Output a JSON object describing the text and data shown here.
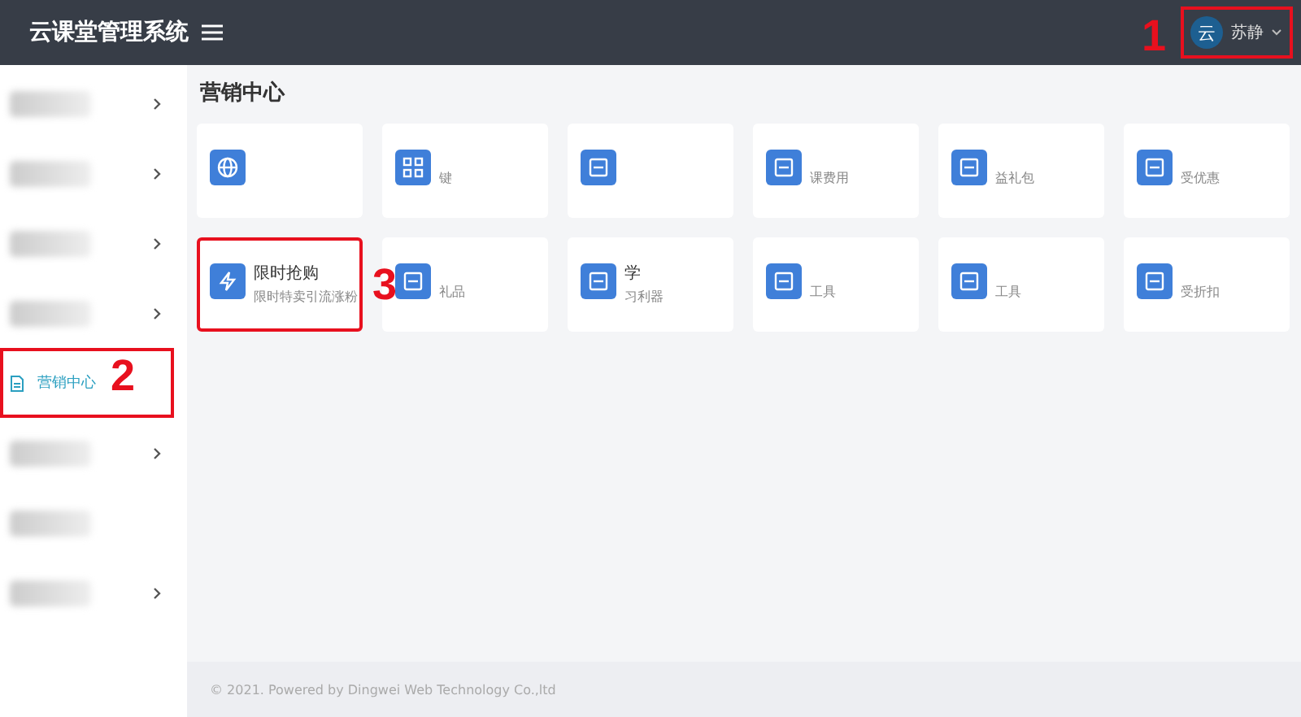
{
  "header": {
    "title": "云课堂管理系统",
    "user": {
      "name": "苏静",
      "avatar_text": "云",
      "callout": "1"
    }
  },
  "sidebar": {
    "items": [
      {
        "kind": "group",
        "selected": false
      },
      {
        "kind": "group",
        "selected": false
      },
      {
        "kind": "group",
        "selected": false
      },
      {
        "kind": "group",
        "selected": false
      },
      {
        "kind": "link",
        "label": "营销中心",
        "selected": true,
        "callout": "2"
      },
      {
        "kind": "group",
        "selected": false
      },
      {
        "kind": "link",
        "selected": false
      },
      {
        "kind": "group",
        "selected": false
      }
    ]
  },
  "page_title": "营销中心",
  "cards": [
    {
      "kind": "globe"
    },
    {
      "kind": "grid",
      "subtitle": "键"
    },
    {
      "kind": "doc"
    },
    {
      "kind": "doc",
      "subtitle": "课费用"
    },
    {
      "kind": "doc",
      "subtitle": "益礼包"
    },
    {
      "kind": "doc",
      "subtitle": "受优惠"
    },
    {
      "kind": "bolt",
      "title": "限时抢购",
      "subtitle": "限时特卖引流涨粉",
      "callout": "3"
    },
    {
      "kind": "doc",
      "subtitle": "礼品"
    },
    {
      "kind": "doc",
      "title": "学",
      "subtitle": "习利器"
    },
    {
      "kind": "doc",
      "subtitle": "工具"
    },
    {
      "kind": "doc",
      "subtitle": "工具"
    },
    {
      "kind": "doc",
      "subtitle": "受折扣"
    }
  ],
  "footer": "© 2021. Powered by Dingwei Web Technology Co.,ltd"
}
